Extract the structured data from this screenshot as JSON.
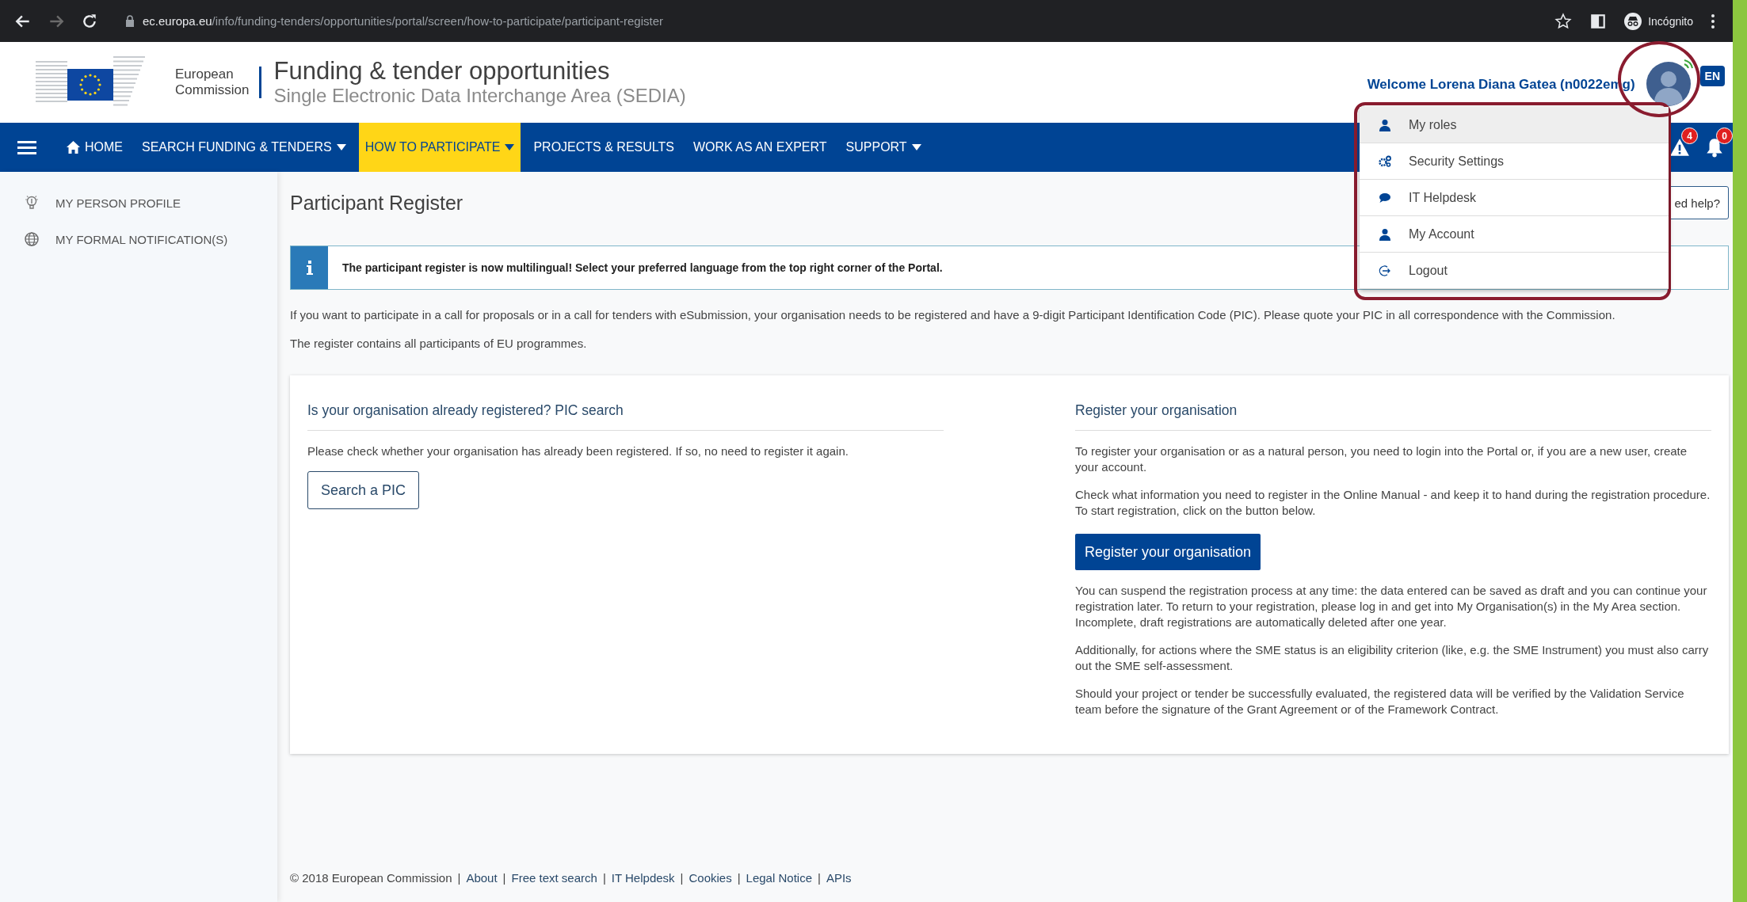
{
  "browser": {
    "nav_buttons": [
      {
        "kind": "back",
        "disabled": false
      },
      {
        "kind": "forward",
        "disabled": true
      },
      {
        "kind": "reload",
        "disabled": false
      }
    ],
    "url_host": "ec.europa.eu",
    "url_path": "/info/funding-tenders/opportunities/portal/screen/how-to-participate/participant-register",
    "profile": "Incógnito"
  },
  "header": {
    "logo_text": "European Commission",
    "title": "Funding & tender opportunities",
    "subtitle": "Single Electronic Data Interchange Area (SEDIA)",
    "welcome": "Welcome Lorena Diana Gatea (n0022emg)",
    "language": "EN"
  },
  "nav": {
    "items": [
      {
        "label": "HOME",
        "kind": "home",
        "selected": false,
        "dropdown": false
      },
      {
        "label": "SEARCH FUNDING & TENDERS",
        "kind": "link",
        "selected": false,
        "dropdown": true
      },
      {
        "label": "HOW TO PARTICIPATE",
        "kind": "link",
        "selected": true,
        "dropdown": true
      },
      {
        "label": "PROJECTS & RESULTS",
        "kind": "link",
        "selected": false,
        "dropdown": false
      },
      {
        "label": "WORK AS AN EXPERT",
        "kind": "link",
        "selected": false,
        "dropdown": false
      },
      {
        "label": "SUPPORT",
        "kind": "link",
        "selected": false,
        "dropdown": true
      }
    ],
    "alerts": [
      {
        "kind": "warning",
        "count": "4"
      },
      {
        "kind": "bell",
        "count": "0"
      }
    ]
  },
  "sidebar": {
    "items": [
      {
        "label": "MY PERSON PROFILE",
        "kind": "bulb"
      },
      {
        "label": "MY FORMAL NOTIFICATION(S)",
        "kind": "globe"
      }
    ]
  },
  "page": {
    "title": "Participant Register",
    "help_button": "ed help?",
    "notice": "The participant register is now multilingual! Select your preferred language from the top right corner of the Portal.",
    "intro": [
      "If you want to participate in a call for proposals or in a call for tenders with eSubmission, your organisation needs to be registered and have a 9-digit Participant Identification Code (PIC). Please quote your PIC in all correspondence with the Commission.",
      "The register contains all participants of EU programmes."
    ]
  },
  "cards": [
    {
      "heading": "Is your organisation already registered? PIC search",
      "blocks": [
        {
          "kind": "text",
          "text": "Please check whether your organisation has already been registered. If so, no need to register it again."
        },
        {
          "kind": "outline-button",
          "text": "Search a PIC"
        }
      ]
    },
    {
      "heading": "Register your organisation",
      "blocks": [
        {
          "kind": "text",
          "text": "To register your organisation or as a natural person, you need to login into the Portal or, if you are a new user, create your account."
        },
        {
          "kind": "text",
          "text": "Check what information you need to register in the Online Manual - and keep it to hand during the registration procedure. To start registration, click on the button below."
        },
        {
          "kind": "primary-button",
          "text": "Register your organisation"
        },
        {
          "kind": "text",
          "text": "You can suspend the registration process at any time: the data entered can be saved as draft and you can continue your registration later. To return to your registration, please log in and get into My Organisation(s) in the My Area section. Incomplete, draft registrations are automatically deleted after one year."
        },
        {
          "kind": "text",
          "text": "Additionally, for actions where the SME status is an eligibility criterion (like, e.g. the SME Instrument) you must also carry out the SME self-assessment."
        },
        {
          "kind": "text",
          "text": "Should your project or tender be successfully evaluated, the registered data will be verified by the Validation Service team before the signature of the Grant Agreement or of the Framework Contract."
        }
      ]
    }
  ],
  "footer": {
    "separator": "|",
    "items": [
      {
        "kind": "text",
        "text": "© 2018 European Commission"
      },
      {
        "kind": "link",
        "text": "About"
      },
      {
        "kind": "link",
        "text": "Free text search"
      },
      {
        "kind": "link",
        "text": "IT Helpdesk"
      },
      {
        "kind": "link",
        "text": "Cookies"
      },
      {
        "kind": "link",
        "text": "Legal Notice"
      },
      {
        "kind": "link",
        "text": "APIs"
      }
    ]
  },
  "user_menu": {
    "items": [
      {
        "label": "My roles",
        "kind": "person",
        "selected": true
      },
      {
        "label": "Security Settings",
        "kind": "gears",
        "selected": false
      },
      {
        "label": "IT Helpdesk",
        "kind": "chat",
        "selected": false
      },
      {
        "label": "My Account",
        "kind": "person",
        "selected": false
      },
      {
        "label": "Logout",
        "kind": "logout",
        "selected": false
      }
    ]
  }
}
